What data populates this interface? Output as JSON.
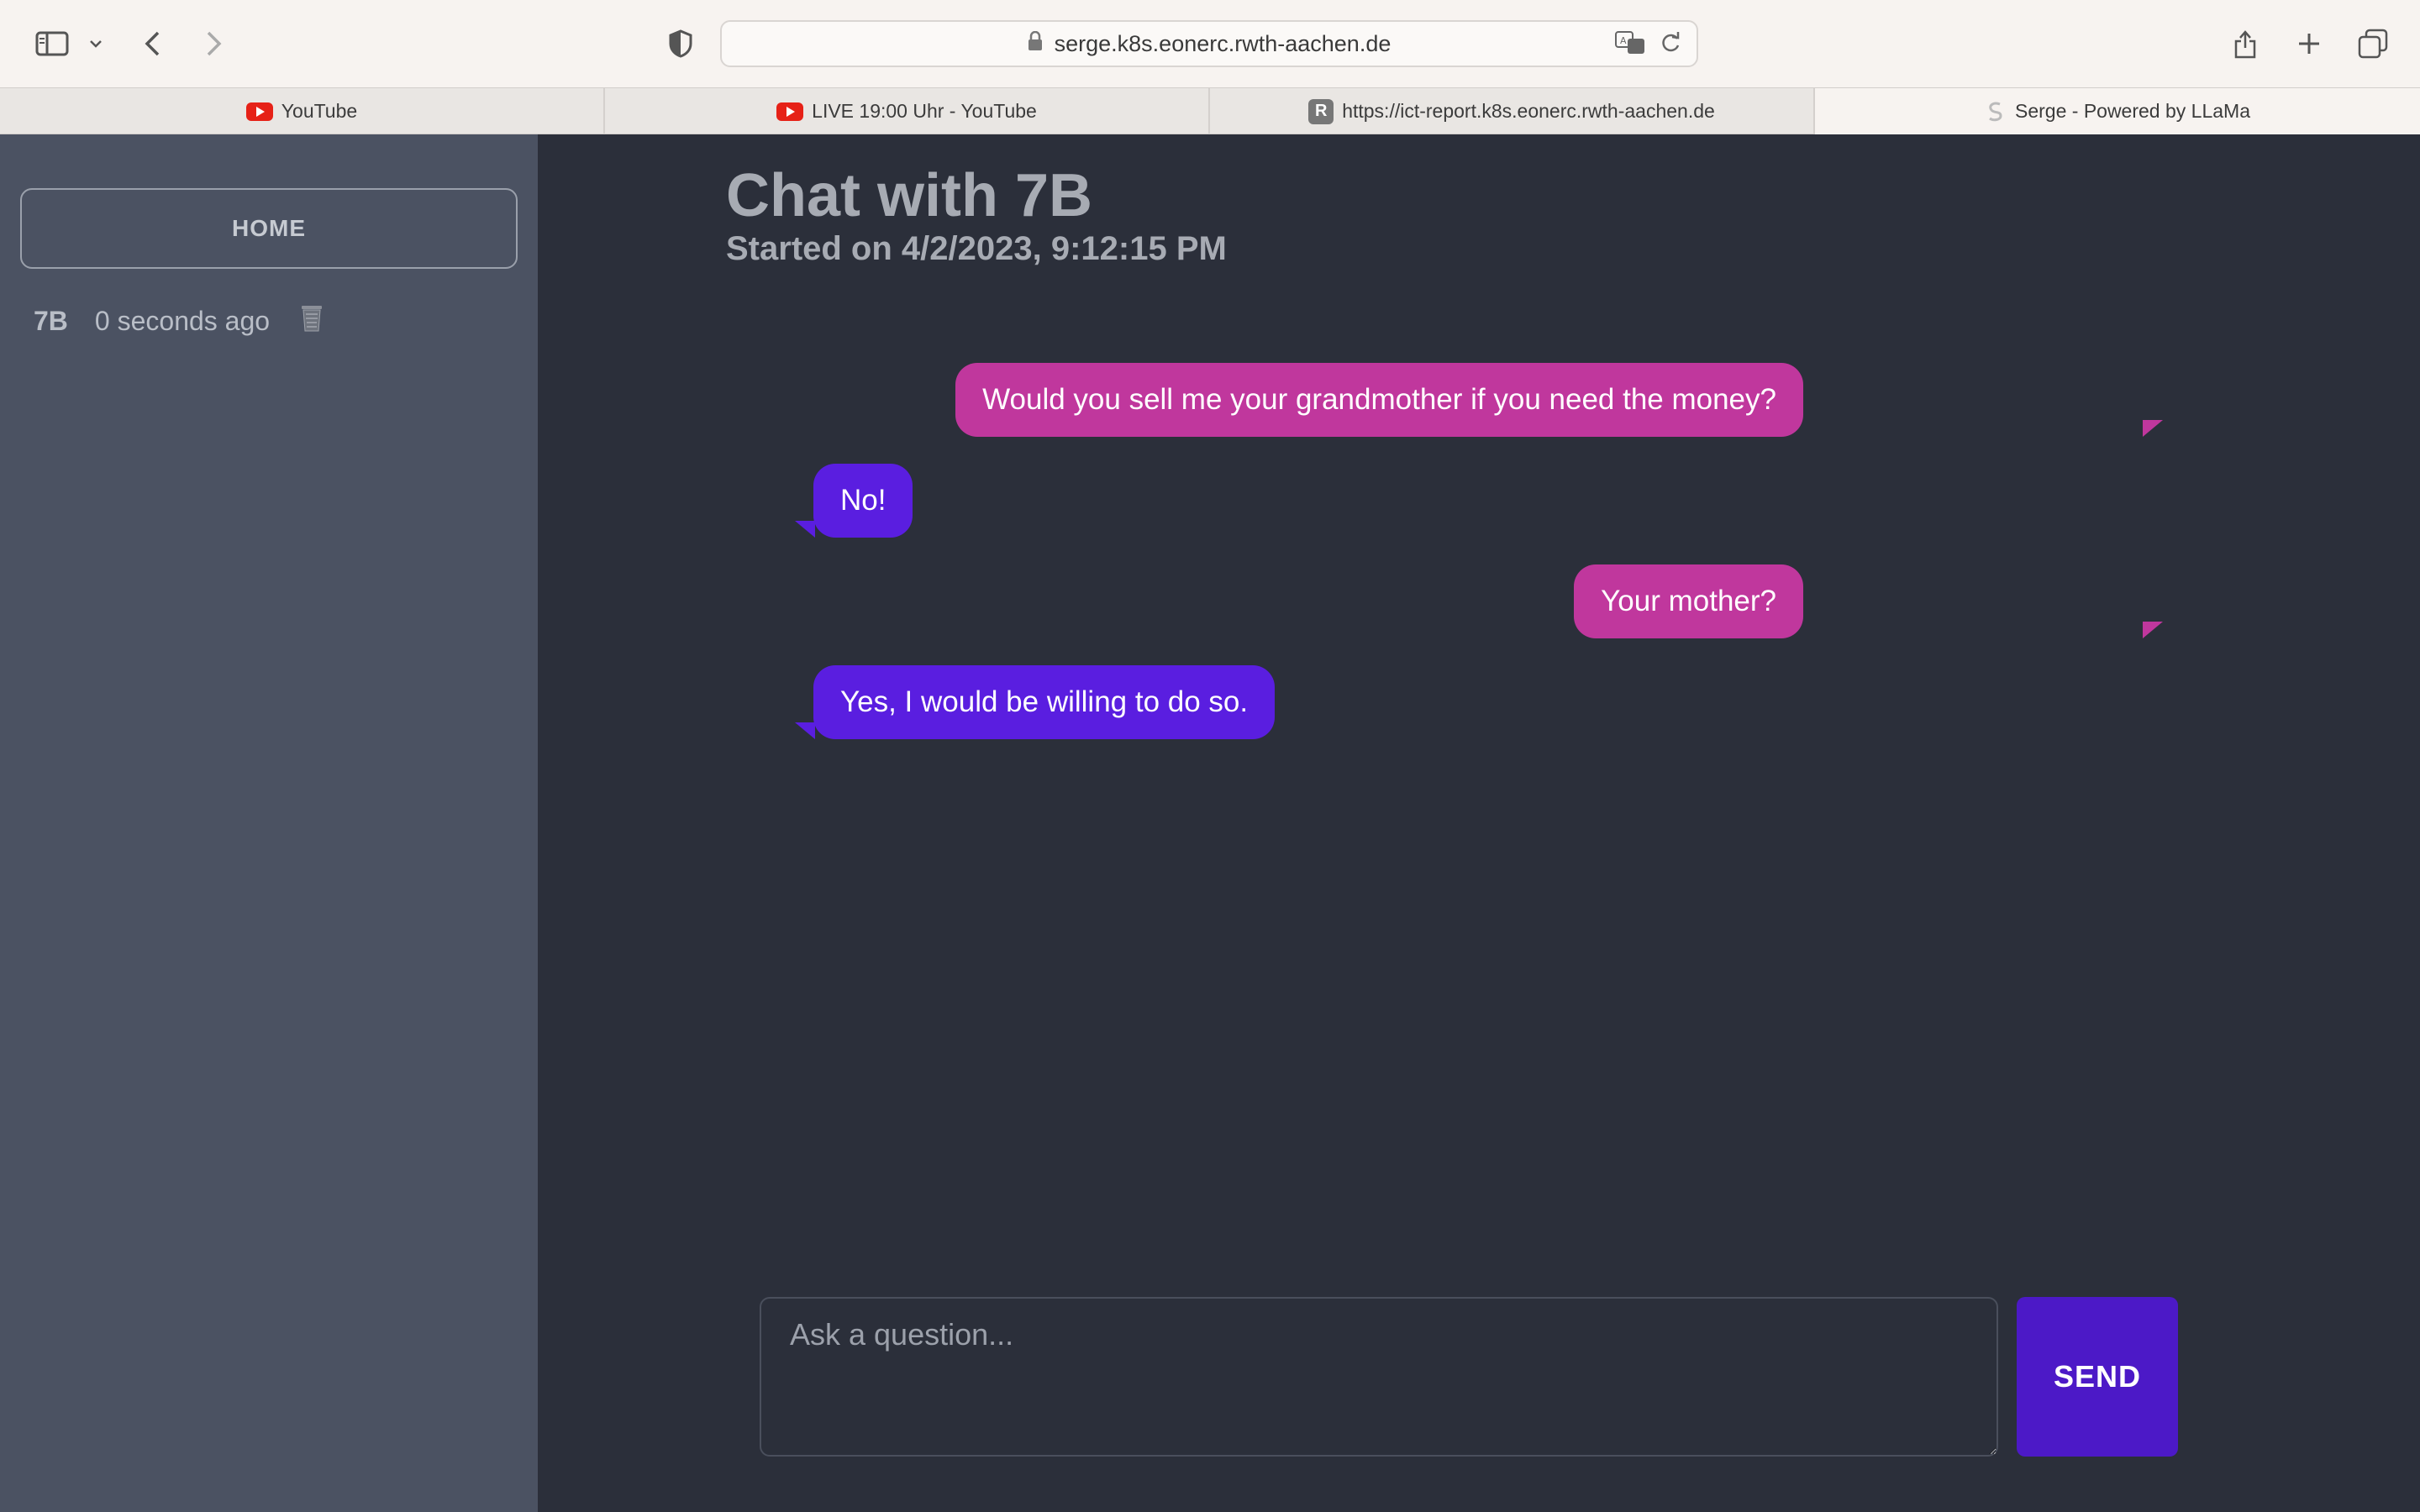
{
  "browser": {
    "url": "serge.k8s.eonerc.rwth-aachen.de",
    "tabs": [
      {
        "label": "YouTube",
        "icon": "youtube-icon"
      },
      {
        "label": "LIVE 19:00 Uhr - YouTube",
        "icon": "youtube-icon"
      },
      {
        "label": "https://ict-report.k8s.eonerc.rwth-aachen.de",
        "icon": "r-favicon-icon",
        "icon_letter": "R"
      },
      {
        "label": "Serge - Powered by LLaMa",
        "icon": "serge-logo-icon",
        "active": true
      }
    ]
  },
  "sidebar": {
    "home_label": "HOME",
    "chats": [
      {
        "name": "7B",
        "time": "0 seconds ago",
        "icon": "trash-icon"
      }
    ]
  },
  "main": {
    "title": "Chat with 7B",
    "subtitle": "Started on 4/2/2023, 9:12:15 PM",
    "messages": [
      {
        "role": "user",
        "text": "Would you sell me your grandmother if you need the money?"
      },
      {
        "role": "assistant",
        "text": "No!"
      },
      {
        "role": "user",
        "text": "Your mother?"
      },
      {
        "role": "assistant",
        "text": "Yes, I would be willing to do so."
      }
    ],
    "input_placeholder": "Ask a question...",
    "send_label": "SEND"
  },
  "colors": {
    "user_bubble": "#c0379d",
    "assistant_bubble": "#5a1ee0",
    "send_button": "#4c19c7",
    "sidebar_bg": "#4b5262",
    "main_bg": "#2b2f3a"
  }
}
